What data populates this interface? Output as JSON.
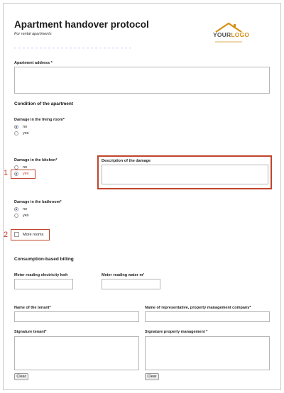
{
  "form": {
    "title": "Apartment handover protocol",
    "subtitle": "For rental apartments"
  },
  "logo": {
    "your": "YOUR",
    "logo": "LOGO",
    "accent_color": "#d59017"
  },
  "address": {
    "label": "Apartment address *"
  },
  "condition": {
    "heading": "Condition of the apartment",
    "living_room": {
      "label": "Damage in the living room*",
      "options": [
        "no",
        "yes"
      ],
      "selected": "no"
    },
    "kitchen": {
      "label": "Damage in the kitchen*",
      "options": [
        "no",
        "yes"
      ],
      "selected": "yes",
      "description_label": "Description of the damage"
    },
    "bathroom": {
      "label": "Damage in the bathroom*",
      "options": [
        "no",
        "yes"
      ],
      "selected": "no"
    },
    "more_rooms_label": "More rooms"
  },
  "callouts": {
    "one": "1",
    "two": "2",
    "color": "#c0442b"
  },
  "billing": {
    "heading": "Consumption-based billing",
    "electricity_label": "Meter reading electricity kwh",
    "water_label": "Meter reading water m³"
  },
  "people": {
    "tenant_label": "Name of the tenant*",
    "representative_label": "Name of representative, property management company*",
    "signature_tenant_label": "Signature tenant*",
    "signature_management_label": "Signature property management *",
    "clear_label": "Clear"
  }
}
